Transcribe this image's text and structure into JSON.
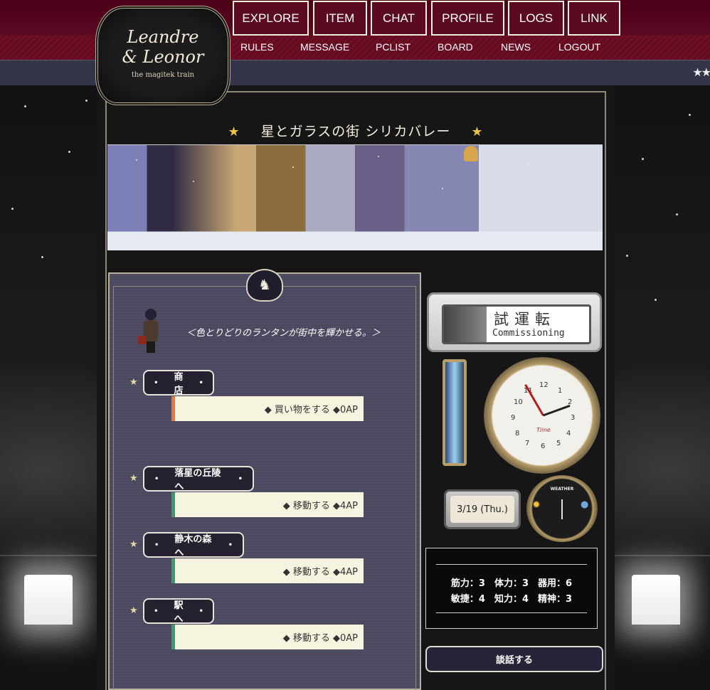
{
  "site": {
    "logo_line1": "Leandre",
    "logo_line2": "& Leonor",
    "logo_sub": "the magitek train"
  },
  "nav": {
    "main": [
      "EXPLORE",
      "ITEM",
      "CHAT",
      "PROFILE",
      "LOGS",
      "LINK"
    ],
    "sub": [
      "RULES",
      "MESSAGE",
      "PCLIST",
      "BOARD",
      "NEWS",
      "LOGOUT"
    ],
    "ticker": "★★"
  },
  "location": {
    "title": "星とガラスの街 シリカバレー",
    "flavor": "＜色とりどりのランタンが街中を輝かせる。＞"
  },
  "spots": [
    {
      "label": "商店",
      "action": "◆ 買い物をする ◆0AP",
      "accent": "#e07c3b"
    },
    {
      "label": "落星の丘陵へ",
      "action": "◆ 移動する ◆4AP",
      "accent": "#3d9a6f"
    },
    {
      "label": "静木の森へ",
      "action": "◆ 移動する ◆4AP",
      "accent": "#3d9a6f"
    },
    {
      "label": "駅へ",
      "action": "◆ 移動する ◆0AP",
      "accent": "#3d9a6f"
    }
  ],
  "status": {
    "sign_jp": "試運転",
    "sign_en": "Commissioning",
    "date": "3/19 (Thu.)",
    "clock_label": "Time",
    "weather_label": "WEATHER",
    "stats_row1": "筋力：3　体力：3　器用：6",
    "stats_row2": "敏捷：4　知力：4　精神：3"
  },
  "talk_button": "談話する",
  "colors": {
    "nav_bg": "#5a0a21",
    "panel_bg": "#4f4d63",
    "accent_orange": "#e07c3b",
    "accent_green": "#3d9a6f"
  }
}
